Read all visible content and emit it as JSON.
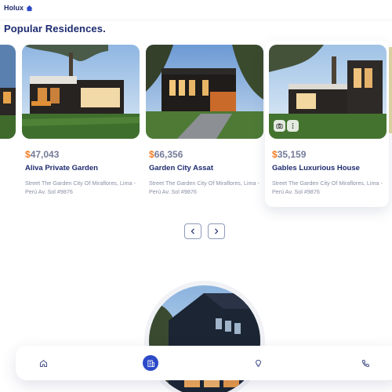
{
  "header": {
    "brand": "Holux",
    "brand_icon": "home-icon"
  },
  "section": {
    "title": "Popular Residences."
  },
  "cards": [
    {
      "price_symbol": "$",
      "price_value": "47,043",
      "name": "Aliva Private Garden",
      "address": "Street The Garden City Of Miraflores, Lima - Perú Av. Sol #9876"
    },
    {
      "price_symbol": "$",
      "price_value": "66,356",
      "name": "Garden City Assat",
      "address": "Street The Garden City Of Miraflores, Lima - Perú Av. Sol #9876"
    },
    {
      "price_symbol": "$",
      "price_value": "35,159",
      "name": "Gables Luxurious House",
      "address": "Street The Garden City Of Miraflores, Lima - Perú Av. Sol #9876"
    }
  ],
  "pager": {
    "prev_icon": "chevron-left-icon",
    "next_icon": "chevron-right-icon"
  },
  "nav": {
    "items": [
      "home-icon",
      "building-icon",
      "lightbulb-icon",
      "phone-icon"
    ],
    "active_index": 1
  },
  "colors": {
    "brand": "#1d2b6f",
    "accent": "#2c49c8",
    "price_symbol": "#f47c20"
  }
}
